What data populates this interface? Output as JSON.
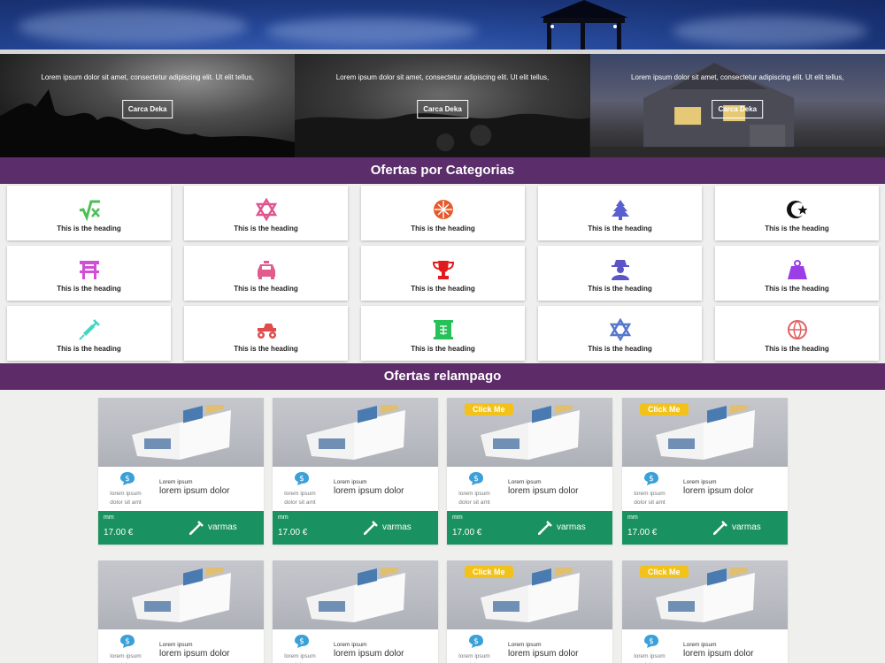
{
  "banners": [
    {
      "text": "Lorem ipsum dolor sit amet, consectetur adipiscing elit. Ut elit tellus,",
      "button": "Carca Deka"
    },
    {
      "text": "Lorem ipsum dolor sit amet, consectetur adipiscing elit. Ut elit tellus,",
      "button": "Carca Deka"
    },
    {
      "text": "Lorem ipsum dolor sit amet, consectetur adipiscing elit. Ut elit tellus,",
      "button": "Carca Deka"
    }
  ],
  "categories_title": "Ofertas por Categorias",
  "categories": [
    {
      "label": "This is the heading",
      "icon": "square-root-icon",
      "color": "#4dbf58"
    },
    {
      "label": "This is the heading",
      "icon": "star-of-david-icon",
      "color": "#e0558f"
    },
    {
      "label": "This is the heading",
      "icon": "waffle-icon",
      "color": "#e5592a"
    },
    {
      "label": "This is the heading",
      "icon": "tree-icon",
      "color": "#5a5fcf"
    },
    {
      "label": "This is the heading",
      "icon": "star-and-crescent-icon",
      "color": "#111111"
    },
    {
      "label": "This is the heading",
      "icon": "torii-gate-icon",
      "color": "#d04fd6"
    },
    {
      "label": "This is the heading",
      "icon": "taxi-icon",
      "color": "#e35a8c"
    },
    {
      "label": "This is the heading",
      "icon": "trophy-icon",
      "color": "#e11b1b"
    },
    {
      "label": "This is the heading",
      "icon": "user-secret-icon",
      "color": "#5b55c8"
    },
    {
      "label": "This is the heading",
      "icon": "weight-icon",
      "color": "#9a3ee6"
    },
    {
      "label": "This is the heading",
      "icon": "syringe-icon",
      "color": "#3ed6c4"
    },
    {
      "label": "This is the heading",
      "icon": "truck-monster-icon",
      "color": "#e04b4b"
    },
    {
      "label": "This is the heading",
      "icon": "torah-icon",
      "color": "#27c15a"
    },
    {
      "label": "This is the heading",
      "icon": "star-of-david-icon",
      "color": "#5577cc"
    },
    {
      "label": "This is the heading",
      "icon": "basketball-icon",
      "color": "#e06060"
    }
  ],
  "offers_title": "Ofertas relampago",
  "offers": [
    {
      "tag": "",
      "small_label": "lorem ipsum dolor sit amt",
      "tiny_label": "Lorem ipsum",
      "main_label": "lorem ipsum dolor",
      "foot_small": "mm",
      "price": "17.00 €",
      "action": "varmas"
    },
    {
      "tag": "",
      "small_label": "lorem ipsum dolor sit amt",
      "tiny_label": "Lorem ipsum",
      "main_label": "lorem ipsum dolor",
      "foot_small": "mm",
      "price": "17.00 €",
      "action": "varmas"
    },
    {
      "tag": "Click Me",
      "small_label": "lorem ipsum dolor sit amt",
      "tiny_label": "Lorem ipsum",
      "main_label": "lorem ipsum dolor",
      "foot_small": "mm",
      "price": "17.00 €",
      "action": "varmas"
    },
    {
      "tag": "Click Me",
      "small_label": "lorem ipsum dolor sit amt",
      "tiny_label": "Lorem ipsum",
      "main_label": "lorem ipsum dolor",
      "foot_small": "mm",
      "price": "17.00 €",
      "action": "varmas"
    },
    {
      "tag": "",
      "small_label": "lorem ipsum dolor",
      "tiny_label": "Lorem ipsum",
      "main_label": "lorem ipsum dolor",
      "foot_small": "",
      "price": "",
      "action": ""
    },
    {
      "tag": "",
      "small_label": "lorem ipsum dolor",
      "tiny_label": "Lorem ipsum",
      "main_label": "lorem ipsum dolor",
      "foot_small": "",
      "price": "",
      "action": ""
    },
    {
      "tag": "Click Me",
      "small_label": "lorem ipsum dolor",
      "tiny_label": "Lorem ipsum",
      "main_label": "lorem ipsum dolor",
      "foot_small": "",
      "price": "",
      "action": ""
    },
    {
      "tag": "Click Me",
      "small_label": "lorem ipsum dolor",
      "tiny_label": "Lorem ipsum",
      "main_label": "lorem ipsum dolor",
      "foot_small": "",
      "price": "",
      "action": ""
    }
  ],
  "colors": {
    "purple_bar": "#5b2d6b",
    "green_foot": "#1a9160",
    "click_tag": "#f2c21a"
  }
}
